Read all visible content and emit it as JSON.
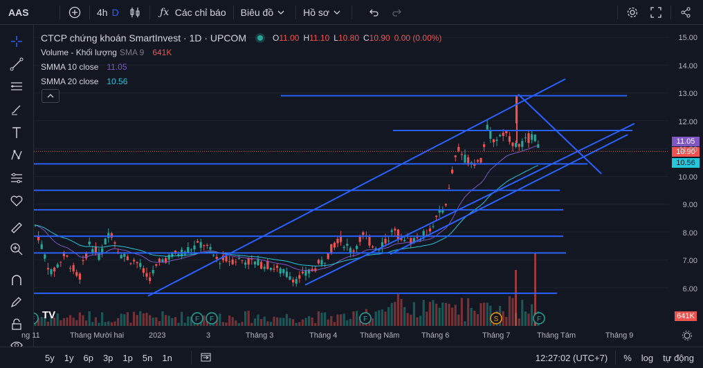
{
  "toolbar": {
    "symbol": "AAS",
    "interval": "4h",
    "interval_marker": "D",
    "indicators_label": "Các chỉ báo",
    "chart_label": "Biêu đồ",
    "profile_label": "Hồ sơ"
  },
  "legend": {
    "title": "CTCP chứng khoán SmartInvest · 1D · UPCOM",
    "ohlc": {
      "o_label": "O",
      "o": "11.00",
      "h_label": "H",
      "h": "11.10",
      "l_label": "L",
      "l": "10.80",
      "c_label": "C",
      "c": "10.90",
      "change": "0.00 (0.00%)"
    },
    "volume_label": "Volume - Khối lượng",
    "volume_sma": "SMA 9",
    "volume_value": "641K",
    "smma10_label": "SMMA 10 close",
    "smma10_value": "11.05",
    "smma20_label": "SMMA 20 close",
    "smma20_value": "10.56"
  },
  "price_axis": {
    "labels": [
      "15.00",
      "14.00",
      "13.00",
      "12.00",
      "11.00",
      "10.00",
      "9.00",
      "8.00",
      "7.00",
      "6.00"
    ],
    "tag_smma10": "11.05",
    "tag_close": "10.90",
    "tag_smma20": "10.56",
    "tag_volume": "641K"
  },
  "time_axis": {
    "labels": [
      "ng 11",
      "Tháng Mười hai",
      "2023",
      "3",
      "Tháng 3",
      "Tháng 4",
      "Tháng Năm",
      "Tháng 6",
      "Tháng 7",
      "Tháng Tám",
      "Tháng 9"
    ]
  },
  "bottombar": {
    "ranges": [
      "5y",
      "1y",
      "6p",
      "3p",
      "1p",
      "5n",
      "1n"
    ],
    "time": "12:27:02 (UTC+7)",
    "percent": "%",
    "log": "log",
    "auto": "tự động"
  },
  "events": {
    "f": "F",
    "s": "S"
  },
  "colors": {
    "background": "#131722",
    "up": "#26a69a",
    "down": "#ef5350",
    "smma10": "#7e57c2",
    "smma20": "#26c6da",
    "drawing": "#2962ff"
  }
}
